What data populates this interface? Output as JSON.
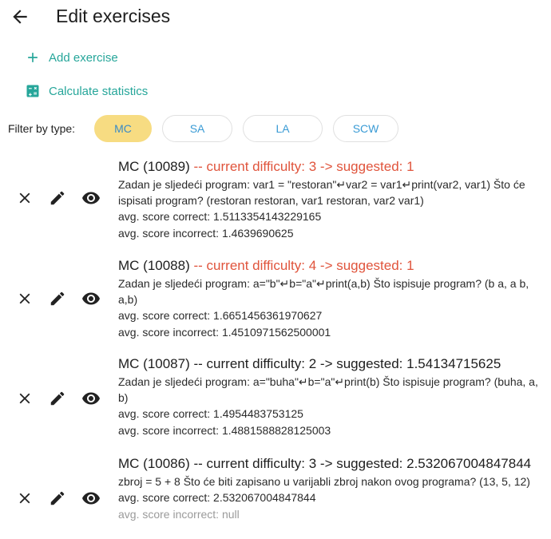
{
  "header": {
    "title": "Edit exercises",
    "back_icon": "arrow-left-icon"
  },
  "actions": {
    "add_label": "Add exercise",
    "add_icon": "plus-icon",
    "stats_label": "Calculate statistics",
    "stats_icon": "calculator-icon"
  },
  "filter": {
    "label": "Filter by type:",
    "chips": [
      {
        "label": "MC",
        "active": true
      },
      {
        "label": "SA",
        "active": false
      },
      {
        "label": "LA",
        "active": false
      },
      {
        "label": "SCW",
        "active": false
      }
    ]
  },
  "colors": {
    "accent": "#26a69a",
    "chip_active": "#f7dc82",
    "warning": "#e0543c",
    "chip_text": "#3a9bd5"
  },
  "exercises": [
    {
      "id_label": "MC (10089)",
      "difficulty": "-- current difficulty: 3 -> suggested: 1",
      "highlight": true,
      "text": "Zadan je sljedeći program: var1 = \"restoran\"↵var2 = var1↵print(var2, var1)  Što će ispisati program? (restoran restoran, var1 restoran, var2 var1)",
      "score_correct": "avg. score correct: 1.5113354143229165",
      "score_incorrect": "avg. score incorrect: 1.4639690625"
    },
    {
      "id_label": "MC (10088)",
      "difficulty": "-- current difficulty: 4 -> suggested: 1",
      "highlight": true,
      "text": "Zadan je sljedeći program: a=\"b\"↵b=\"a\"↵print(a,b)  Što ispisuje program? (b a, a b, a,b)",
      "score_correct": "avg. score correct: 1.6651456361970627",
      "score_incorrect": "avg. score incorrect: 1.4510971562500001"
    },
    {
      "id_label": "MC (10087)",
      "difficulty": "-- current difficulty: 2 -> suggested: 1.54134715625",
      "highlight": false,
      "text": "Zadan je sljedeći program: a=\"buha\"↵b=\"a\"↵print(b)  Što ispisuje program? (buha, a, b)",
      "score_correct": "avg. score correct: 1.4954483753125",
      "score_incorrect": "avg. score incorrect: 1.4881588828125003"
    },
    {
      "id_label": "MC (10086)",
      "difficulty": "-- current difficulty: 3 -> suggested: 2.532067004847844",
      "highlight": false,
      "text": " zbroj = 5 + 8  Što će biti zapisano u varijabli zbroj nakon ovog programa? (13, 5, 12)",
      "score_correct": "avg. score correct: 2.532067004847844",
      "score_incorrect": "avg. score incorrect: null"
    }
  ]
}
